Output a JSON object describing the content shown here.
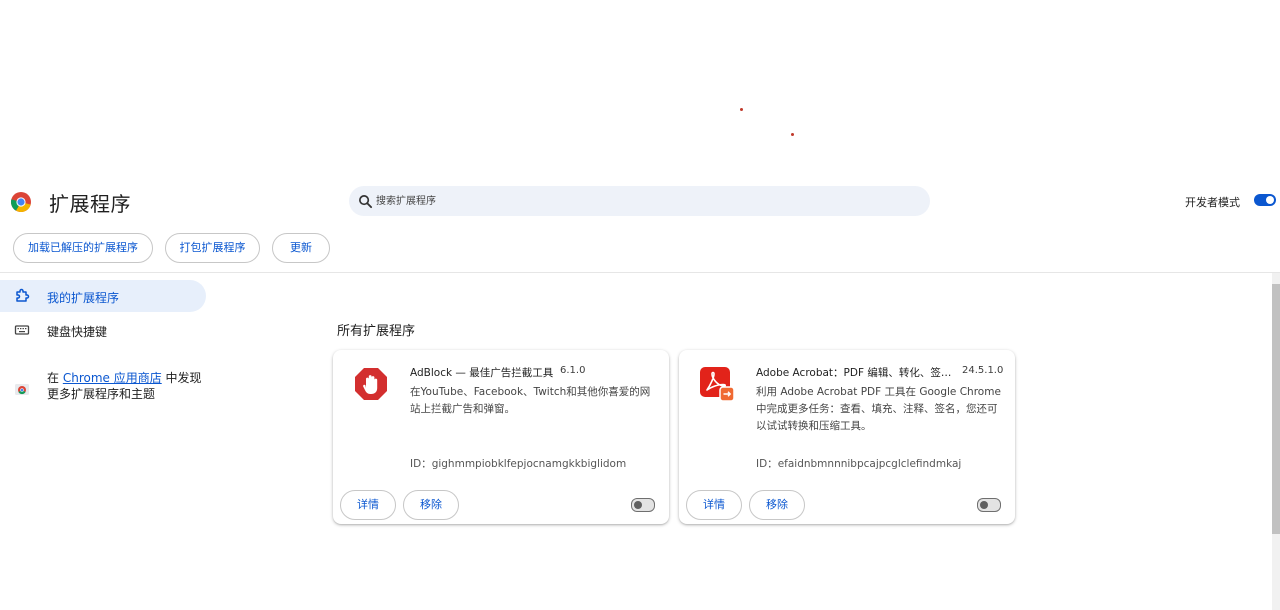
{
  "header": {
    "title": "扩展程序",
    "search_placeholder": "搜索扩展程序",
    "developer_mode_label": "开发者模式",
    "developer_mode_on": true
  },
  "toolbar": {
    "load_unpacked": "加载已解压的扩展程序",
    "pack_extension": "打包扩展程序",
    "update": "更新"
  },
  "sidebar": {
    "items": [
      {
        "label": "我的扩展程序",
        "icon": "puzzle-icon",
        "active": true
      },
      {
        "label": "键盘快捷键",
        "icon": "keyboard-icon",
        "active": false
      }
    ],
    "promo": {
      "prefix": "在 ",
      "link_text": "Chrome 应用商店",
      "suffix": " 中发现",
      "line2": "更多扩展程序和主题"
    }
  },
  "main": {
    "section_title": "所有扩展程序",
    "extensions": [
      {
        "name": "AdBlock — 最佳广告拦截工具",
        "version": "6.1.0",
        "description": "在YouTube、Facebook、Twitch和其他你喜爱的网站上拦截广告和弹窗。",
        "id_label": "ID：",
        "id": "gighmmpiobklfepjocnamgkkbiglidom",
        "details_label": "详情",
        "remove_label": "移除",
        "enabled": false,
        "icon": "adblock-hand-icon"
      },
      {
        "name": "Adobe Acrobat：PDF 编辑、转化、签…",
        "version": "24.5.1.0",
        "description": "利用 Adobe Acrobat PDF 工具在 Google Chrome 中完成更多任务：查看、填充、注释、签名，您还可以试试转换和压缩工具。",
        "id_label": "ID：",
        "id": "efaidnbmnnnibpcajpcglclefindmkaj",
        "details_label": "详情",
        "remove_label": "移除",
        "enabled": false,
        "icon": "acrobat-icon"
      }
    ]
  },
  "colors": {
    "accent": "#0b57d0",
    "active_nav_bg": "#e7effb",
    "search_bg": "#eef2f9",
    "adblock_red": "#d32f2f",
    "acrobat_red": "#e2231a"
  }
}
